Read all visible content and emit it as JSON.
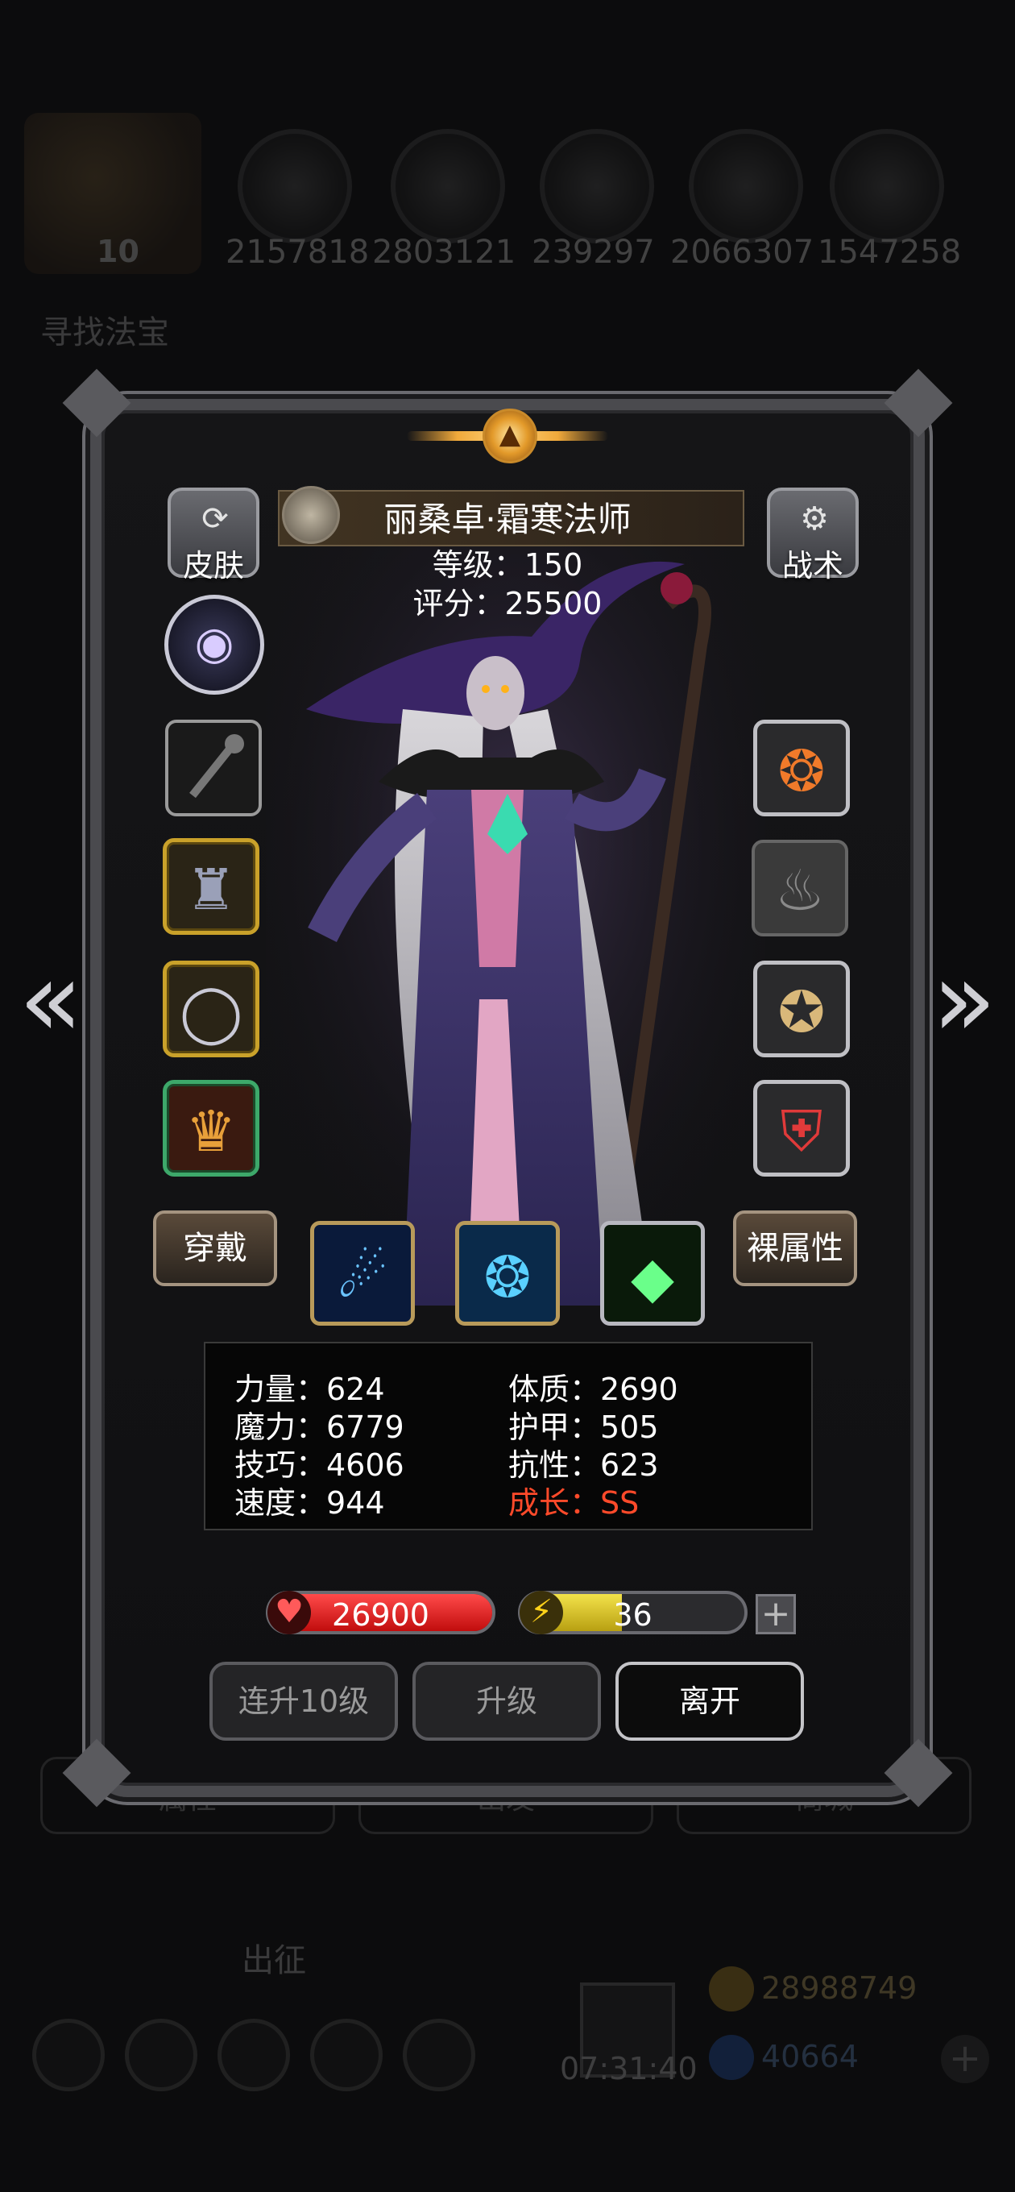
{
  "background": {
    "avatar_level": "10",
    "resources": [
      "2157818",
      "2803121",
      "239297",
      "2066307",
      "1547258"
    ],
    "quest_text": "寻找法宝",
    "tabs": [
      "属性",
      "出发",
      "商城"
    ],
    "march_label": "出征",
    "timer": "07:31:40",
    "gold": "28988749",
    "gems": "40664",
    "plus": "+"
  },
  "dialog": {
    "hero_name": "丽桑卓·霜寒法师",
    "level_line": "等级：150",
    "score_line": "评分：25500",
    "skin_label": "皮肤",
    "tactics_label": "战术",
    "wear_label": "穿戴",
    "naked_attr_label": "裸属性",
    "stats": {
      "str": "力量：624",
      "con": "体质：2690",
      "mag": "魔力：6779",
      "arm": "护甲：505",
      "skl": "技巧：4606",
      "res": "抗性：623",
      "spd": "速度：944",
      "growth": "成长：SS"
    },
    "hp_value": "26900",
    "hp_fill": 1.0,
    "energy_value": "36",
    "energy_fill": 0.45,
    "plus": "+",
    "btn_multi_level": "连升10级",
    "btn_level_up": "升级",
    "btn_leave": "离开",
    "arrow_left": "«",
    "arrow_right": "»"
  },
  "colors": {
    "growth_red": "#ff4a2a",
    "hp_red": "#d41212",
    "energy_yellow": "#e6cf2a",
    "gold_frame": "#c9a12a"
  },
  "icons": {
    "skin": "refresh-icon",
    "tactics": "gear-icon",
    "eye": "eye-icon",
    "slots_left": [
      "staff-icon",
      "robe-icon",
      "ring-icon",
      "crown-icon"
    ],
    "slots_right": [
      "flame-ring-icon",
      "flame-icon",
      "compass-icon",
      "emblem-icon"
    ],
    "skills": [
      "comet-icon",
      "vortex-icon",
      "crystal-icon"
    ]
  }
}
